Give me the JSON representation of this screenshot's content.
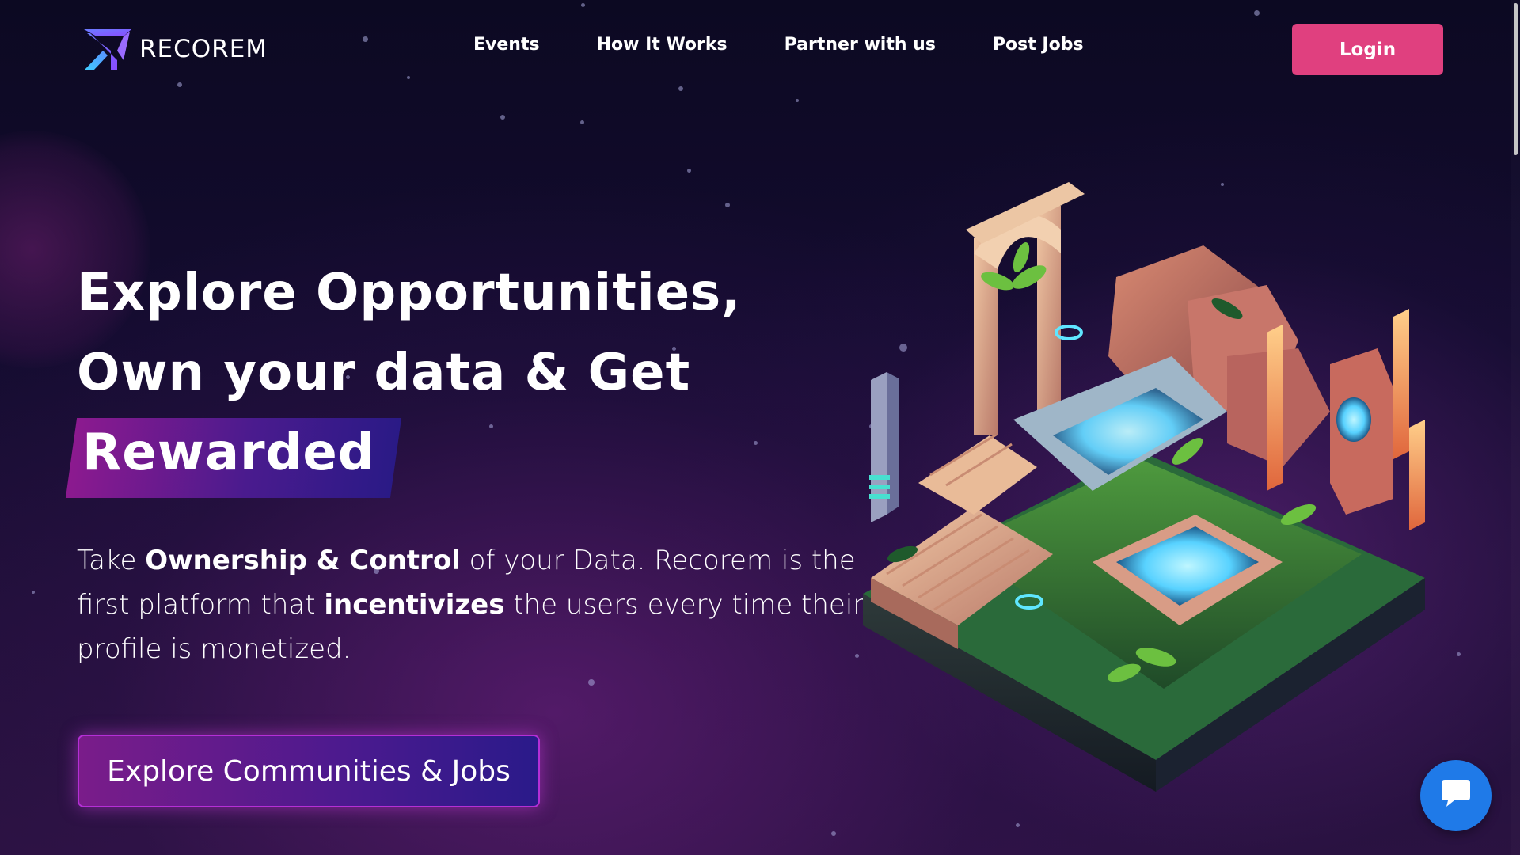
{
  "brand": {
    "name": "RECOREM",
    "logo_icon": "recorem-logo-icon"
  },
  "nav": {
    "items": [
      {
        "label": "Events"
      },
      {
        "label": "How It Works"
      },
      {
        "label": "Partner with us"
      },
      {
        "label": "Post Jobs"
      }
    ],
    "login_label": "Login"
  },
  "hero": {
    "title_line1": "Explore Opportunities,",
    "title_line2": "Own your data & Get",
    "title_highlight": "Rewarded",
    "desc": {
      "p1": "Take ",
      "b1": "Ownership & Control",
      "p2": " of your Data. Recorem is the first platform that ",
      "b2": "incentivizes",
      "p3": " the users every time their profile is monetized."
    },
    "cta_label": "Explore Communities & Jobs"
  },
  "chat": {
    "icon": "chat-bubble-icon"
  },
  "colors": {
    "background": "#0d0a24",
    "login_button": "#e0407f",
    "highlight_start": "#8c1a8f",
    "highlight_end": "#2a1a86",
    "chat_button": "#1f7ae8"
  }
}
